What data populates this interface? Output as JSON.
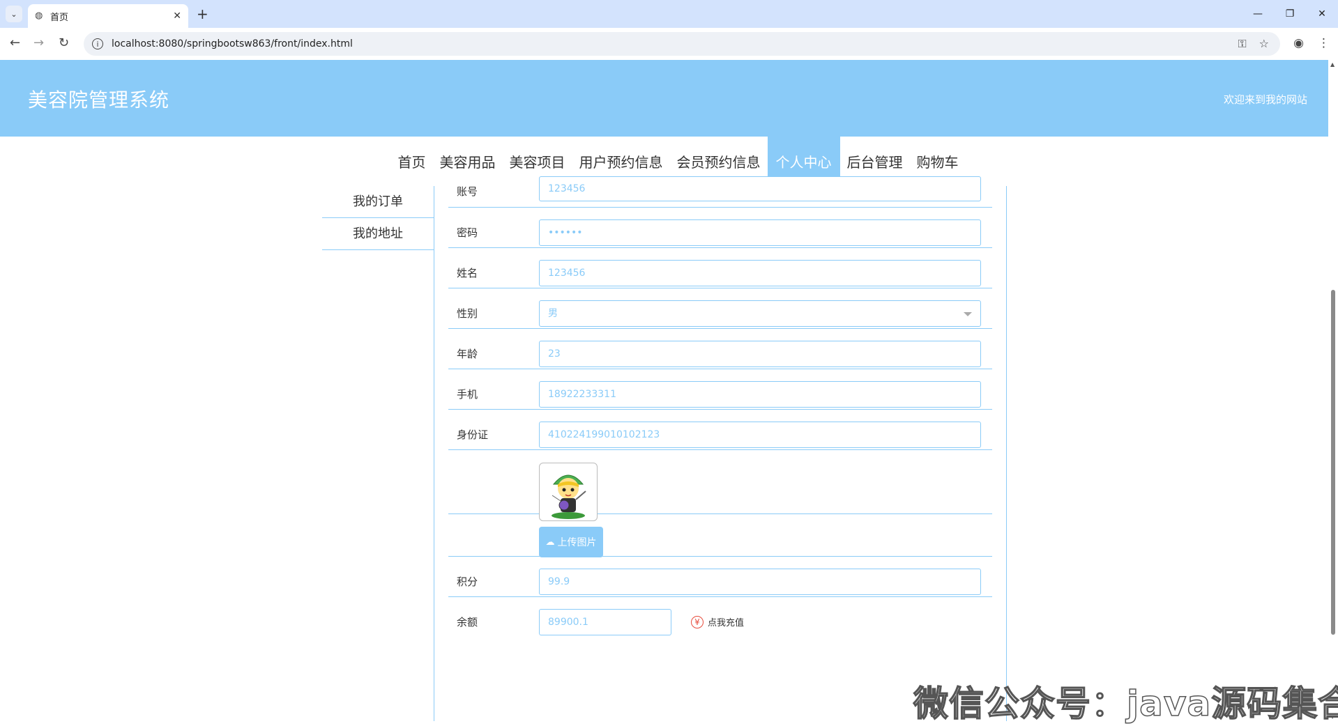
{
  "browser": {
    "tab_title": "首页",
    "url": "localhost:8080/springbootsw863/front/index.html"
  },
  "header": {
    "site_title": "美容院管理系统",
    "welcome": "欢迎来到我的网站"
  },
  "nav": {
    "items": [
      "首页",
      "美容用品",
      "美容项目",
      "用户预约信息",
      "会员预约信息",
      "个人中心",
      "后台管理",
      "购物车"
    ],
    "active": "个人中心"
  },
  "side_menu": {
    "items": [
      "我的订单",
      "我的地址"
    ]
  },
  "form": {
    "account_label": "账号",
    "account_value": "123456",
    "password_label": "密码",
    "password_value": "••••••",
    "name_label": "姓名",
    "name_value": "123456",
    "gender_label": "性别",
    "gender_value": "男",
    "age_label": "年龄",
    "age_value": "23",
    "phone_label": "手机",
    "phone_value": "18922233311",
    "idcard_label": "身份证",
    "idcard_value": "410224199010102123",
    "upload_label": "上传图片",
    "points_label": "积分",
    "points_value": "99.9",
    "balance_label": "余额",
    "balance_value": "89900.1",
    "recharge_label": "点我充值"
  },
  "watermark": "微信公众号：java源码集合",
  "colors": {
    "accent": "#8acbf8",
    "danger": "#e74c3c"
  }
}
